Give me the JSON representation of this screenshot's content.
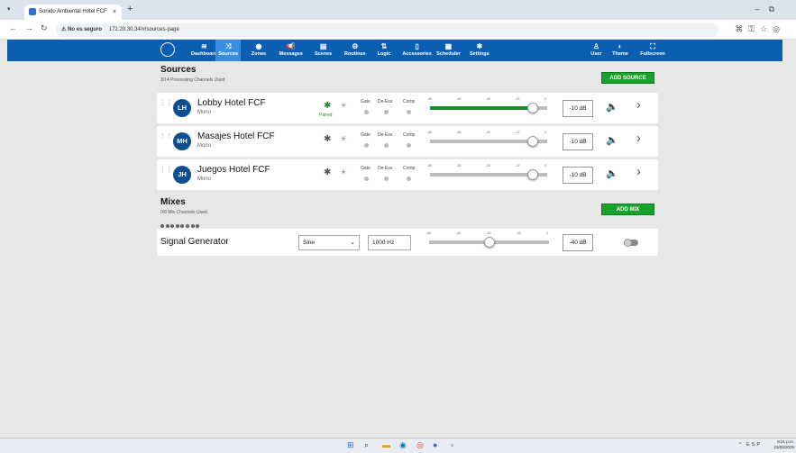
{
  "browser": {
    "tab_title": "Sonido Ambiental Hotel FCF",
    "tab_close": "×",
    "new_tab": "+",
    "security_label": "No es seguro",
    "url": "172.20.30.34/#/sources-page",
    "minimize": "–",
    "maximize": "⧉"
  },
  "nav": {
    "items": [
      {
        "label": "Dashboard",
        "icon": "chart-icon",
        "glyph": "≋"
      },
      {
        "label": "Sources",
        "icon": "shuffle-icon",
        "glyph": "⤨"
      },
      {
        "label": "Zones",
        "icon": "layers-icon",
        "glyph": "◉"
      },
      {
        "label": "Messages",
        "icon": "megaphone-icon",
        "glyph": "📢"
      },
      {
        "label": "Scenes",
        "icon": "scene-icon",
        "glyph": "▤"
      },
      {
        "label": "Routines",
        "icon": "routine-icon",
        "glyph": "⚙"
      },
      {
        "label": "Logic",
        "icon": "logic-icon",
        "glyph": "⇅"
      },
      {
        "label": "Accessories",
        "icon": "accessory-icon",
        "glyph": "▯"
      },
      {
        "label": "Scheduler",
        "icon": "calendar-icon",
        "glyph": "▦"
      },
      {
        "label": "Settings",
        "icon": "gear-icon",
        "glyph": "✱"
      },
      {
        "label": "User",
        "icon": "user-icon",
        "glyph": "♙"
      },
      {
        "label": "Theme",
        "icon": "theme-icon",
        "glyph": "◐"
      },
      {
        "label": "Fullscreen",
        "icon": "fullscreen-icon",
        "glyph": "⛶"
      }
    ],
    "active": "Sources"
  },
  "sources": {
    "title": "Sources",
    "subtitle": "3/14 Processing Channels Used",
    "add_label": "ADD SOURCE",
    "items": [
      {
        "initials": "LH",
        "name": "Lobby Hotel FCF",
        "type": "Mono",
        "paired": true,
        "paired_label": "Paired",
        "level_db": "-10 dB",
        "level_fraction": 0.88
      },
      {
        "initials": "MH",
        "name": "Masajes Hotel FCF",
        "type": "Mono",
        "paired": false,
        "paired_label": "",
        "level_db": "-10 dB",
        "level_fraction": 0.88
      },
      {
        "initials": "JH",
        "name": "Juegos Hotel FCF",
        "type": "Mono",
        "paired": false,
        "paired_label": "",
        "level_db": "-10 dB",
        "level_fraction": 0.88
      }
    ],
    "gate_labels": [
      "Gate",
      "De-Ess",
      "Comp"
    ],
    "ticks": [
      "-80",
      "-60",
      "-40",
      "-22",
      "0"
    ]
  },
  "mixes": {
    "title": "Mixes",
    "subtitle": "0/8 Mix Channels Used",
    "add_label": "ADD MIX"
  },
  "signal_generator": {
    "label": "Signal Generator",
    "waveform": "Sine",
    "frequency": "1000 Hz",
    "level_db": "-40 dB",
    "level_fraction": 0.5,
    "ticks": [
      "-80",
      "-60",
      "-40",
      "-20",
      "0"
    ]
  },
  "taskbar": {
    "tray": "^ ESP",
    "time": "9:21 p.m.",
    "date": "23/02/2025"
  }
}
